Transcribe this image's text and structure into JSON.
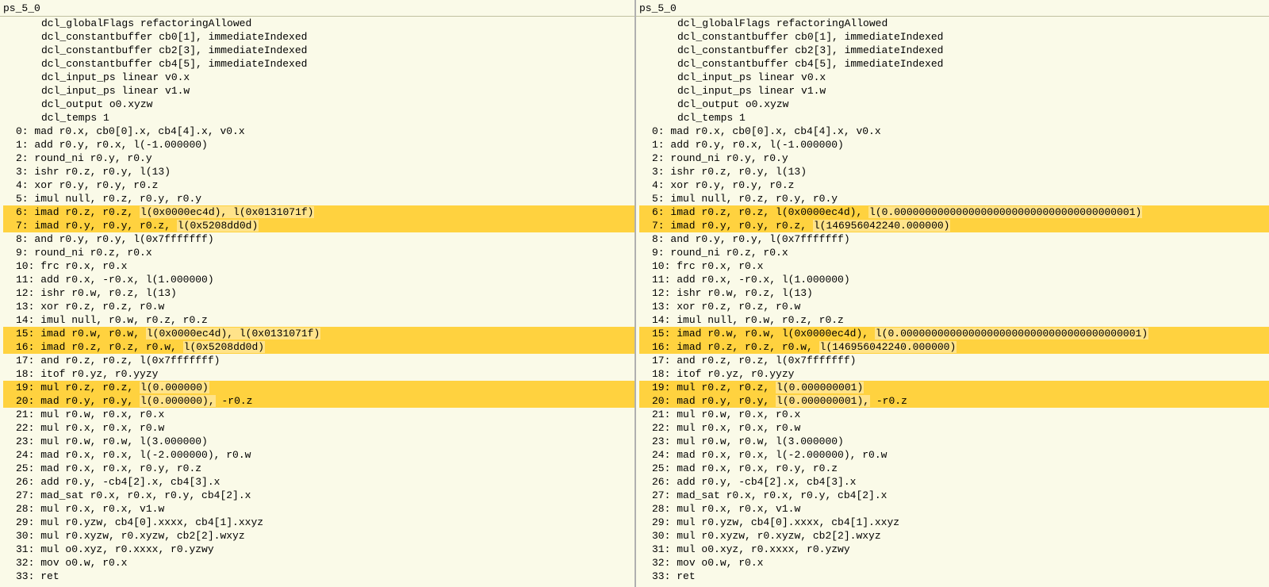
{
  "colors": {
    "bg": "#fafae8",
    "row_highlight": "#ffd23f",
    "diff_segment": "#ffe38a"
  },
  "panes": [
    {
      "title": "ps_5_0",
      "decls": [
        "dcl_globalFlags refactoringAllowed",
        "dcl_constantbuffer cb0[1], immediateIndexed",
        "dcl_constantbuffer cb2[3], immediateIndexed",
        "dcl_constantbuffer cb4[5], immediateIndexed",
        "dcl_input_ps linear v0.x",
        "dcl_input_ps linear v1.w",
        "dcl_output o0.xyzw",
        "dcl_temps 1"
      ],
      "instr": [
        {
          "n": " 0",
          "pre": "mad r0.x, cb0[0].x, cb4[4].x, v0.x"
        },
        {
          "n": " 1",
          "pre": "add r0.y, r0.x, l(-1.000000)"
        },
        {
          "n": " 2",
          "pre": "round_ni r0.y, r0.y"
        },
        {
          "n": " 3",
          "pre": "ishr r0.z, r0.y, l(13)"
        },
        {
          "n": " 4",
          "pre": "xor r0.y, r0.y, r0.z"
        },
        {
          "n": " 5",
          "pre": "imul null, r0.z, r0.y, r0.y"
        },
        {
          "n": " 6",
          "hl": true,
          "pre": "imad r0.z, r0.z, ",
          "seg": "l(0x0000ec4d), l(0x0131071f)"
        },
        {
          "n": " 7",
          "hl": true,
          "pre": "imad r0.y, r0.y, r0.z, ",
          "seg": "l(0x5208dd0d)"
        },
        {
          "n": " 8",
          "pre": "and r0.y, r0.y, l(0x7fffffff)"
        },
        {
          "n": " 9",
          "pre": "round_ni r0.z, r0.x"
        },
        {
          "n": "10",
          "pre": "frc r0.x, r0.x"
        },
        {
          "n": "11",
          "pre": "add r0.x, -r0.x, l(1.000000)"
        },
        {
          "n": "12",
          "pre": "ishr r0.w, r0.z, l(13)"
        },
        {
          "n": "13",
          "pre": "xor r0.z, r0.z, r0.w"
        },
        {
          "n": "14",
          "pre": "imul null, r0.w, r0.z, r0.z"
        },
        {
          "n": "15",
          "hl": true,
          "pre": "imad r0.w, r0.w, ",
          "seg": "l(0x0000ec4d), l(0x0131071f)"
        },
        {
          "n": "16",
          "hl": true,
          "pre": "imad r0.z, r0.z, r0.w, ",
          "seg": "l(0x5208dd0d)"
        },
        {
          "n": "17",
          "pre": "and r0.z, r0.z, l(0x7fffffff)"
        },
        {
          "n": "18",
          "pre": "itof r0.yz, r0.yyzy"
        },
        {
          "n": "19",
          "hl": true,
          "pre": "mul r0.z, r0.z, ",
          "seg": "l(0.000000)"
        },
        {
          "n": "20",
          "hl": true,
          "pre": "mad r0.y, r0.y, ",
          "seg": "l(0.000000),",
          "post": " -r0.z"
        },
        {
          "n": "21",
          "pre": "mul r0.w, r0.x, r0.x"
        },
        {
          "n": "22",
          "pre": "mul r0.x, r0.x, r0.w"
        },
        {
          "n": "23",
          "pre": "mul r0.w, r0.w, l(3.000000)"
        },
        {
          "n": "24",
          "pre": "mad r0.x, r0.x, l(-2.000000), r0.w"
        },
        {
          "n": "25",
          "pre": "mad r0.x, r0.x, r0.y, r0.z"
        },
        {
          "n": "26",
          "pre": "add r0.y, -cb4[2].x, cb4[3].x"
        },
        {
          "n": "27",
          "pre": "mad_sat r0.x, r0.x, r0.y, cb4[2].x"
        },
        {
          "n": "28",
          "pre": "mul r0.x, r0.x, v1.w"
        },
        {
          "n": "29",
          "pre": "mul r0.yzw, cb4[0].xxxx, cb4[1].xxyz"
        },
        {
          "n": "30",
          "pre": "mul r0.xyzw, r0.xyzw, cb2[2].wxyz"
        },
        {
          "n": "31",
          "pre": "mul o0.xyz, r0.xxxx, r0.yzwy"
        },
        {
          "n": "32",
          "pre": "mov o0.w, r0.x"
        },
        {
          "n": "33",
          "pre": "ret"
        }
      ]
    },
    {
      "title": "ps_5_0",
      "decls": [
        "dcl_globalFlags refactoringAllowed",
        "dcl_constantbuffer cb0[1], immediateIndexed",
        "dcl_constantbuffer cb2[3], immediateIndexed",
        "dcl_constantbuffer cb4[5], immediateIndexed",
        "dcl_input_ps linear v0.x",
        "dcl_input_ps linear v1.w",
        "dcl_output o0.xyzw",
        "dcl_temps 1"
      ],
      "instr": [
        {
          "n": " 0",
          "pre": "mad r0.x, cb0[0].x, cb4[4].x, v0.x"
        },
        {
          "n": " 1",
          "pre": "add r0.y, r0.x, l(-1.000000)"
        },
        {
          "n": " 2",
          "pre": "round_ni r0.y, r0.y"
        },
        {
          "n": " 3",
          "pre": "ishr r0.z, r0.y, l(13)"
        },
        {
          "n": " 4",
          "pre": "xor r0.y, r0.y, r0.z"
        },
        {
          "n": " 5",
          "pre": "imul null, r0.z, r0.y, r0.y"
        },
        {
          "n": " 6",
          "hl": true,
          "pre": "imad r0.z, r0.z, l(0x0000ec4d), ",
          "seg": "l(0.000000000000000000000000000000000000001)"
        },
        {
          "n": " 7",
          "hl": true,
          "pre": "imad r0.y, r0.y, r0.z, ",
          "seg": "l(146956042240.000000)"
        },
        {
          "n": " 8",
          "pre": "and r0.y, r0.y, l(0x7fffffff)"
        },
        {
          "n": " 9",
          "pre": "round_ni r0.z, r0.x"
        },
        {
          "n": "10",
          "pre": "frc r0.x, r0.x"
        },
        {
          "n": "11",
          "pre": "add r0.x, -r0.x, l(1.000000)"
        },
        {
          "n": "12",
          "pre": "ishr r0.w, r0.z, l(13)"
        },
        {
          "n": "13",
          "pre": "xor r0.z, r0.z, r0.w"
        },
        {
          "n": "14",
          "pre": "imul null, r0.w, r0.z, r0.z"
        },
        {
          "n": "15",
          "hl": true,
          "pre": "imad r0.w, r0.w, l(0x0000ec4d), ",
          "seg": "l(0.000000000000000000000000000000000000001)"
        },
        {
          "n": "16",
          "hl": true,
          "pre": "imad r0.z, r0.z, r0.w, ",
          "seg": "l(146956042240.000000)"
        },
        {
          "n": "17",
          "pre": "and r0.z, r0.z, l(0x7fffffff)"
        },
        {
          "n": "18",
          "pre": "itof r0.yz, r0.yyzy"
        },
        {
          "n": "19",
          "hl": true,
          "pre": "mul r0.z, r0.z, ",
          "seg": "l(0.000000001)"
        },
        {
          "n": "20",
          "hl": true,
          "pre": "mad r0.y, r0.y, ",
          "seg": "l(0.000000001),",
          "post": " -r0.z"
        },
        {
          "n": "21",
          "pre": "mul r0.w, r0.x, r0.x"
        },
        {
          "n": "22",
          "pre": "mul r0.x, r0.x, r0.w"
        },
        {
          "n": "23",
          "pre": "mul r0.w, r0.w, l(3.000000)"
        },
        {
          "n": "24",
          "pre": "mad r0.x, r0.x, l(-2.000000), r0.w"
        },
        {
          "n": "25",
          "pre": "mad r0.x, r0.x, r0.y, r0.z"
        },
        {
          "n": "26",
          "pre": "add r0.y, -cb4[2].x, cb4[3].x"
        },
        {
          "n": "27",
          "pre": "mad_sat r0.x, r0.x, r0.y, cb4[2].x"
        },
        {
          "n": "28",
          "pre": "mul r0.x, r0.x, v1.w"
        },
        {
          "n": "29",
          "pre": "mul r0.yzw, cb4[0].xxxx, cb4[1].xxyz"
        },
        {
          "n": "30",
          "pre": "mul r0.xyzw, r0.xyzw, cb2[2].wxyz"
        },
        {
          "n": "31",
          "pre": "mul o0.xyz, r0.xxxx, r0.yzwy"
        },
        {
          "n": "32",
          "pre": "mov o0.w, r0.x"
        },
        {
          "n": "33",
          "pre": "ret"
        }
      ]
    }
  ]
}
